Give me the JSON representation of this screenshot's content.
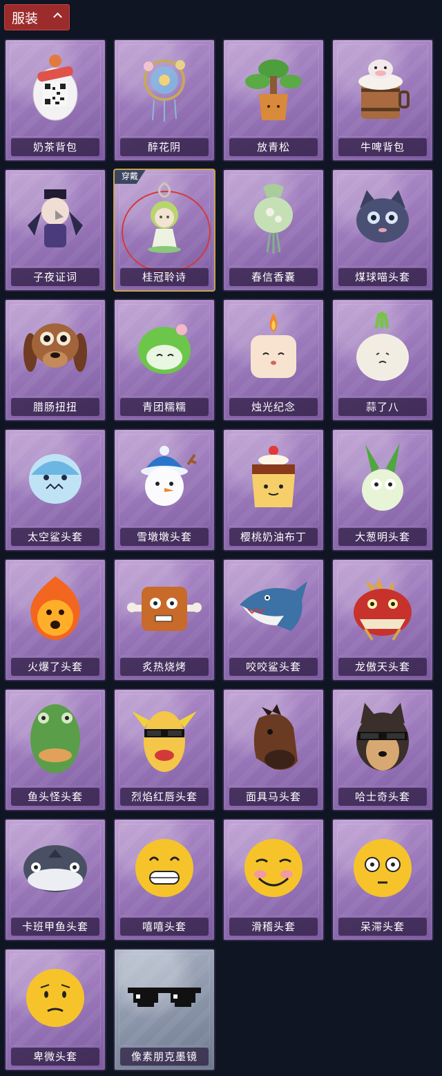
{
  "header": {
    "title": "服装"
  },
  "badges": {
    "equipped": "穿戴"
  },
  "items": [
    {
      "label": "奶茶背包",
      "icon": "milk-tea-backpack-icon"
    },
    {
      "label": "醉花阴",
      "icon": "flower-dreamcatcher-icon"
    },
    {
      "label": "放青松",
      "icon": "pine-bonsai-icon"
    },
    {
      "label": "牛啤背包",
      "icon": "beer-keg-cow-icon"
    },
    {
      "label": "子夜证词",
      "icon": "crow-figure-icon"
    },
    {
      "label": "桂冠聆诗",
      "icon": "laurel-doll-charm-icon"
    },
    {
      "label": "春信香囊",
      "icon": "sachet-icon"
    },
    {
      "label": "煤球喵头套",
      "icon": "black-cat-head-icon"
    },
    {
      "label": "腊肠扭扭",
      "icon": "dachshund-head-icon"
    },
    {
      "label": "青团糯糯",
      "icon": "green-dumpling-head-icon"
    },
    {
      "label": "烛光纪念",
      "icon": "candle-head-icon"
    },
    {
      "label": "蒜了八",
      "icon": "garlic-head-icon"
    },
    {
      "label": "太空鲨头套",
      "icon": "space-shark-head-icon"
    },
    {
      "label": "雪墩墩头套",
      "icon": "snowman-head-icon"
    },
    {
      "label": "樱桃奶油布丁",
      "icon": "pudding-head-icon"
    },
    {
      "label": "大葱明头套",
      "icon": "scallion-head-icon"
    },
    {
      "label": "火爆了头套",
      "icon": "fire-head-icon"
    },
    {
      "label": "炙热烧烤",
      "icon": "bbq-meat-head-icon"
    },
    {
      "label": "咬咬鲨头套",
      "icon": "shark-head-icon"
    },
    {
      "label": "龙傲天头套",
      "icon": "dragon-head-icon"
    },
    {
      "label": "鱼头怪头套",
      "icon": "fish-mask-icon"
    },
    {
      "label": "烈焰红唇头套",
      "icon": "red-lips-head-icon"
    },
    {
      "label": "面具马头套",
      "icon": "horse-mask-icon"
    },
    {
      "label": "哈士奇头套",
      "icon": "husky-head-icon"
    },
    {
      "label": "卡班甲鱼头套",
      "icon": "whale-fish-head-icon"
    },
    {
      "label": "嘻嘻头套",
      "icon": "grin-emoji-head-icon"
    },
    {
      "label": "滑稽头套",
      "icon": "funny-emoji-head-icon"
    },
    {
      "label": "呆滞头套",
      "icon": "dazed-emoji-head-icon"
    },
    {
      "label": "卑微头套",
      "icon": "humble-emoji-head-icon"
    },
    {
      "label": "像素朋克墨镜",
      "icon": "pixel-sunglasses-icon"
    }
  ],
  "colors": {
    "background": "#0f1522",
    "header_tab": "#9c2b2b",
    "card_purple": "#9b79bb",
    "card_gray": "#8c96ab",
    "equipped_border": "#c9a250"
  }
}
